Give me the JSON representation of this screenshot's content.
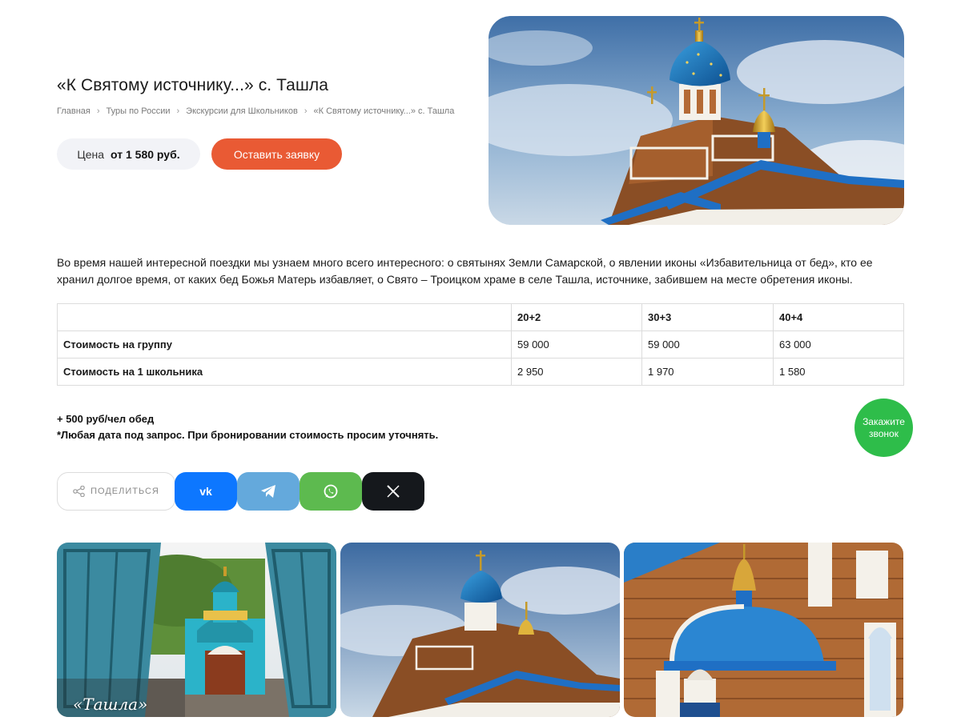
{
  "page": {
    "title": "«К Святому источнику...» с. Ташла"
  },
  "breadcrumb": [
    {
      "label": "Главная"
    },
    {
      "label": "Туры по России"
    },
    {
      "label": "Экскурсии для Школьников"
    },
    {
      "label": "«К Святому источнику...» с. Ташла"
    }
  ],
  "price": {
    "label": "Цена",
    "value": "от 1 580 руб."
  },
  "request_button": "Оставить заявку",
  "intro_text": "Во время нашей интересной поездки мы узнаем много всего интересного: о святынях Земли Самарской, о явлении иконы «Избавительница от бед», кто ее хранил долгое время, от каких бед Божья Матерь избавляет, о Свято – Троицком храме в селе Ташла, источнике, забившем на месте обретения иконы.",
  "price_table": {
    "headers": [
      "",
      "20+2",
      "30+3",
      "40+4"
    ],
    "rows": [
      {
        "label": "Стоимость на группу",
        "values": [
          "59 000",
          "59 000",
          "63 000"
        ]
      },
      {
        "label": "Стоимость на 1 школьника",
        "values": [
          "2 950",
          "1 970",
          "1 580"
        ]
      }
    ]
  },
  "notes": {
    "lunch": "+ 500 руб/чел обед",
    "date": "*Любая дата под запрос. При бронировании стоимость просим уточнять."
  },
  "callback": {
    "line1": "Закажите",
    "line2": "звонок",
    "color": "#2ebd4a"
  },
  "share": {
    "label": "ПОДЕЛИТЬСЯ",
    "networks": [
      {
        "name": "vk",
        "icon": "vk-icon",
        "color": "#0d77ff"
      },
      {
        "name": "telegram",
        "icon": "telegram-icon",
        "color": "#64a9dc"
      },
      {
        "name": "whatsapp",
        "icon": "whatsapp-icon",
        "color": "#5dba4f"
      },
      {
        "name": "x",
        "icon": "x-icon",
        "color": "#15181c"
      }
    ]
  },
  "gallery": {
    "photo1_caption": "«Ташла»"
  },
  "colors": {
    "accent": "#e95a34",
    "price_bg": "#f2f3f7"
  }
}
